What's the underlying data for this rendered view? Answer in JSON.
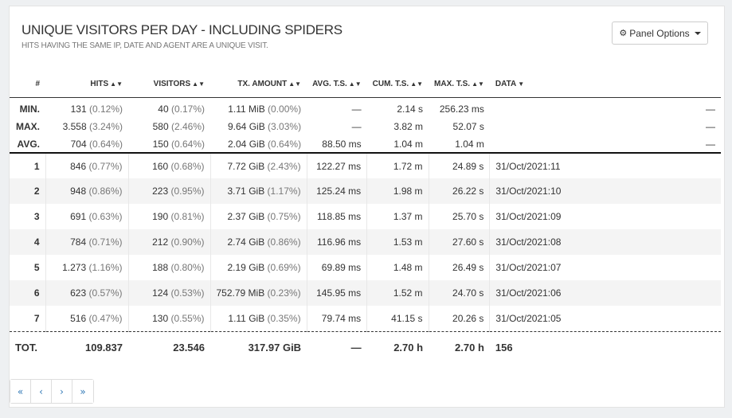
{
  "panel": {
    "title": "UNIQUE VISITORS PER DAY - INCLUDING SPIDERS",
    "subtitle": "HITS HAVING THE SAME IP, DATE AND AGENT ARE A UNIQUE VISIT.",
    "options_label": "Panel Options"
  },
  "columns": {
    "num": "#",
    "hits": "HITS",
    "visitors": "VISITORS",
    "tx_amount": "TX. AMOUNT",
    "avg_ts": "AVG. T.S.",
    "cum_ts": "CUM. T.S.",
    "max_ts": "MAX. T.S.",
    "data": "DATA"
  },
  "summary": {
    "min": {
      "label": "MIN.",
      "hits": "131",
      "hits_pct": "(0.12%)",
      "visitors": "40",
      "visitors_pct": "(0.17%)",
      "tx": "1.11 MiB",
      "tx_pct": "(0.00%)",
      "avg_ts": "—",
      "cum_ts": "2.14 s",
      "max_ts": "256.23 ms",
      "data": "—"
    },
    "max": {
      "label": "MAX.",
      "hits": "3.558",
      "hits_pct": "(3.24%)",
      "visitors": "580",
      "visitors_pct": "(2.46%)",
      "tx": "9.64 GiB",
      "tx_pct": "(3.03%)",
      "avg_ts": "—",
      "cum_ts": "3.82 m",
      "max_ts": "52.07 s",
      "data": "—"
    },
    "avg": {
      "label": "AVG.",
      "hits": "704",
      "hits_pct": "(0.64%)",
      "visitors": "150",
      "visitors_pct": "(0.64%)",
      "tx": "2.04 GiB",
      "tx_pct": "(0.64%)",
      "avg_ts": "88.50 ms",
      "cum_ts": "1.04 m",
      "max_ts": "1.04 m",
      "data": "—"
    }
  },
  "rows": [
    {
      "num": "1",
      "hits": "846",
      "hits_pct": "(0.77%)",
      "visitors": "160",
      "visitors_pct": "(0.68%)",
      "tx": "7.72 GiB",
      "tx_pct": "(2.43%)",
      "avg_ts": "122.27 ms",
      "cum_ts": "1.72 m",
      "max_ts": "24.89 s",
      "data": "31/Oct/2021:11"
    },
    {
      "num": "2",
      "hits": "948",
      "hits_pct": "(0.86%)",
      "visitors": "223",
      "visitors_pct": "(0.95%)",
      "tx": "3.71 GiB",
      "tx_pct": "(1.17%)",
      "avg_ts": "125.24 ms",
      "cum_ts": "1.98 m",
      "max_ts": "26.22 s",
      "data": "31/Oct/2021:10"
    },
    {
      "num": "3",
      "hits": "691",
      "hits_pct": "(0.63%)",
      "visitors": "190",
      "visitors_pct": "(0.81%)",
      "tx": "2.37 GiB",
      "tx_pct": "(0.75%)",
      "avg_ts": "118.85 ms",
      "cum_ts": "1.37 m",
      "max_ts": "25.70 s",
      "data": "31/Oct/2021:09"
    },
    {
      "num": "4",
      "hits": "784",
      "hits_pct": "(0.71%)",
      "visitors": "212",
      "visitors_pct": "(0.90%)",
      "tx": "2.74 GiB",
      "tx_pct": "(0.86%)",
      "avg_ts": "116.96 ms",
      "cum_ts": "1.53 m",
      "max_ts": "27.60 s",
      "data": "31/Oct/2021:08"
    },
    {
      "num": "5",
      "hits": "1.273",
      "hits_pct": "(1.16%)",
      "visitors": "188",
      "visitors_pct": "(0.80%)",
      "tx": "2.19 GiB",
      "tx_pct": "(0.69%)",
      "avg_ts": "69.89 ms",
      "cum_ts": "1.48 m",
      "max_ts": "26.49 s",
      "data": "31/Oct/2021:07"
    },
    {
      "num": "6",
      "hits": "623",
      "hits_pct": "(0.57%)",
      "visitors": "124",
      "visitors_pct": "(0.53%)",
      "tx": "752.79 MiB",
      "tx_pct": "(0.23%)",
      "avg_ts": "145.95 ms",
      "cum_ts": "1.52 m",
      "max_ts": "24.70 s",
      "data": "31/Oct/2021:06"
    },
    {
      "num": "7",
      "hits": "516",
      "hits_pct": "(0.47%)",
      "visitors": "130",
      "visitors_pct": "(0.55%)",
      "tx": "1.11 GiB",
      "tx_pct": "(0.35%)",
      "avg_ts": "79.74 ms",
      "cum_ts": "41.15 s",
      "max_ts": "20.26 s",
      "data": "31/Oct/2021:05"
    }
  ],
  "total": {
    "label": "TOT.",
    "hits": "109.837",
    "visitors": "23.546",
    "tx": "317.97 GiB",
    "avg_ts": "—",
    "cum_ts": "2.70 h",
    "max_ts": "2.70 h",
    "data": "156"
  },
  "pagination": {
    "first": "«",
    "prev": "‹",
    "next": "›",
    "last": "»"
  },
  "icons": {
    "options": "gear-icon",
    "sort": "sort-icon",
    "sort_desc": "caret-down-icon"
  }
}
